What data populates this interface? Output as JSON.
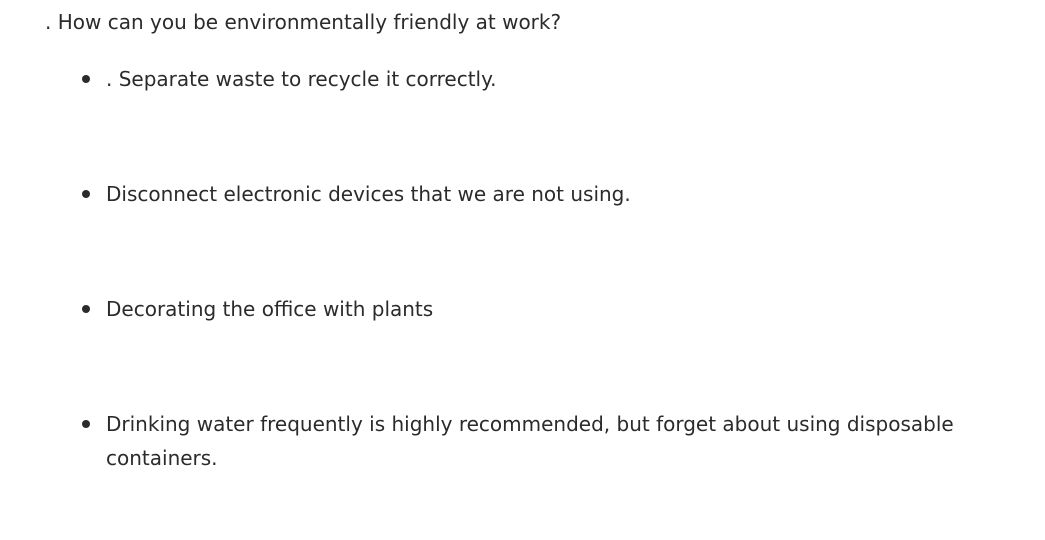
{
  "document": {
    "question": ". How can you be environmentally friendly at work?",
    "items": [
      {
        "text": ". Separate waste to recycle it correctly."
      },
      {
        "text": "Disconnect electronic devices that we are not using."
      },
      {
        "text": "Decorating the office with plants"
      },
      {
        "text": "Drinking water frequently is highly recommended, but forget about using disposable containers."
      }
    ]
  }
}
